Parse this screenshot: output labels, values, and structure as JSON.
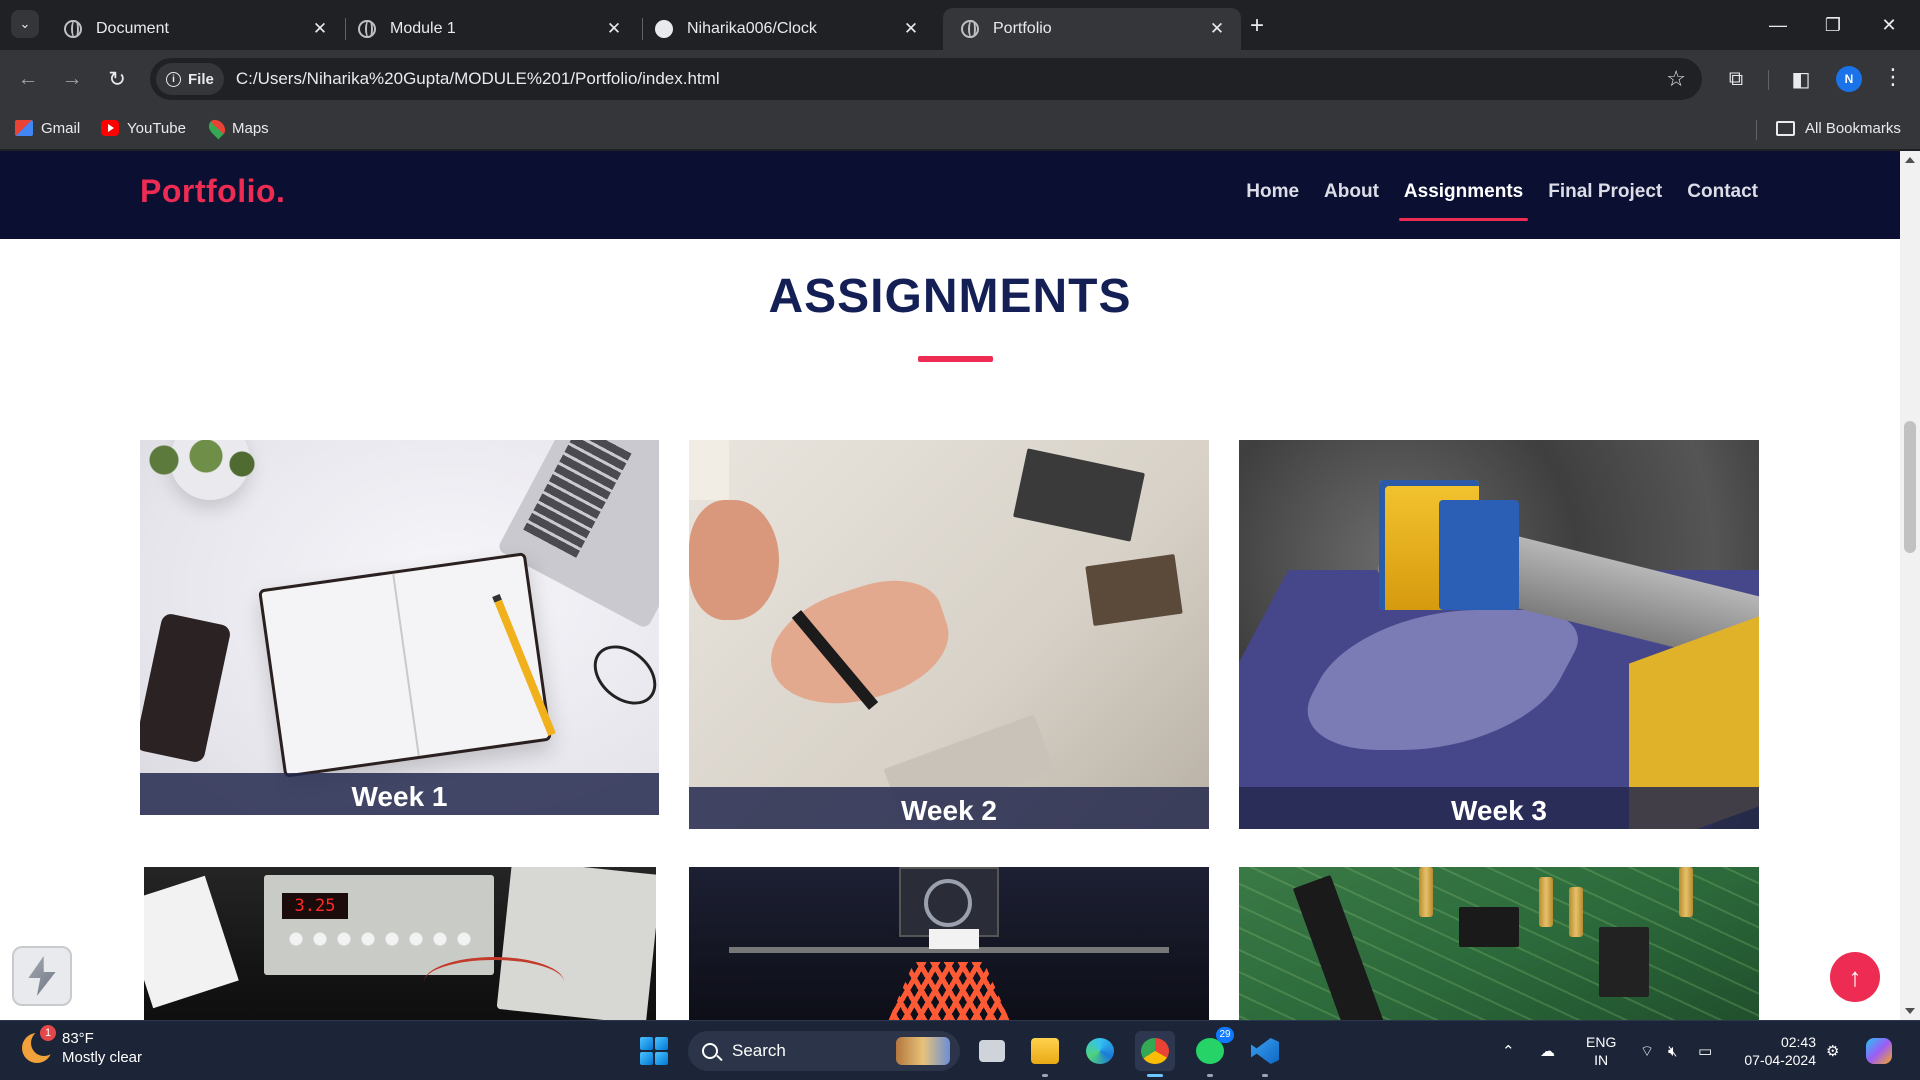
{
  "browser": {
    "tabs": [
      {
        "label": "Document",
        "active": false
      },
      {
        "label": "Module 1",
        "active": false
      },
      {
        "label": "Niharika006/Clock",
        "active": false
      },
      {
        "label": "Portfolio",
        "active": true
      }
    ],
    "address": {
      "chip": "File",
      "url": "C:/Users/Niharika%20Gupta/MODULE%201/Portfolio/index.html"
    },
    "profile_initial": "N",
    "bookmarks": [
      {
        "label": "Gmail",
        "icon": "gmail-icon"
      },
      {
        "label": "YouTube",
        "icon": "youtube-icon"
      },
      {
        "label": "Maps",
        "icon": "maps-icon"
      }
    ],
    "all_bookmarks": "All Bookmarks"
  },
  "site": {
    "logo": "Portfolio.",
    "nav": [
      "Home",
      "About",
      "Assignments",
      "Final Project",
      "Contact"
    ],
    "active_nav": "Assignments",
    "section_title": "ASSIGNMENTS",
    "cards": [
      {
        "caption": "Week 1",
        "image": "notebook-desk"
      },
      {
        "caption": "Week 2",
        "image": "collage-drawing"
      },
      {
        "caption": "Week 3",
        "image": "cnc-plotter"
      },
      {
        "caption": "",
        "image": "lab-equipment"
      },
      {
        "caption": "",
        "image": "3d-printer"
      },
      {
        "caption": "",
        "image": "circuit-board"
      }
    ],
    "instrument_display": "3.25",
    "colors": {
      "accent": "#ee2b52",
      "header": "#0b1033",
      "title": "#142055"
    }
  },
  "taskbar": {
    "weather": {
      "temp": "83°F",
      "desc": "Mostly clear",
      "badge": "1"
    },
    "search": "Search",
    "whatsapp_badge": "29",
    "lang_line1": "ENG",
    "lang_line2": "IN",
    "time": "02:43",
    "date": "07-04-2024"
  }
}
